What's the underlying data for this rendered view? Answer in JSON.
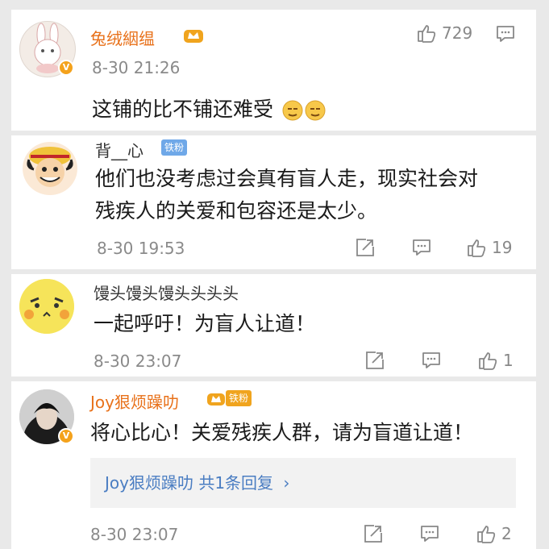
{
  "comments": [
    {
      "username": "兔绒絪缊",
      "time": "8-30 21:26",
      "content": "这铺的比不铺还难受",
      "likes": "729",
      "emoji": "sweat-smile-emoji"
    },
    {
      "username": "背__心",
      "badge": "铁粉",
      "time": "8-30 19:53",
      "content_line1": "他们也没考虑过会真有盲人走，现实社会对",
      "content_line2": "残疾人的关爱和包容还是太少。",
      "likes": "19"
    },
    {
      "username": "馒头馒头馒头头头头",
      "time": "8-30 23:07",
      "content": "一起呼吁！为盲人让道！",
      "likes": "1"
    },
    {
      "username": "Joy狠烦躁叻",
      "badge": "铁粉",
      "time": "8-30 23:07",
      "content": "将心比心！关爱残疾人群，请为盲道让道！",
      "reply_text": "Joy狠烦躁叻  共1条回复",
      "likes": "2"
    }
  ],
  "colors": {
    "vip_name": "#e8711a",
    "link": "#4a7dc2",
    "verified": "#f4a21c",
    "fan_badge": "#6fa8e8"
  }
}
